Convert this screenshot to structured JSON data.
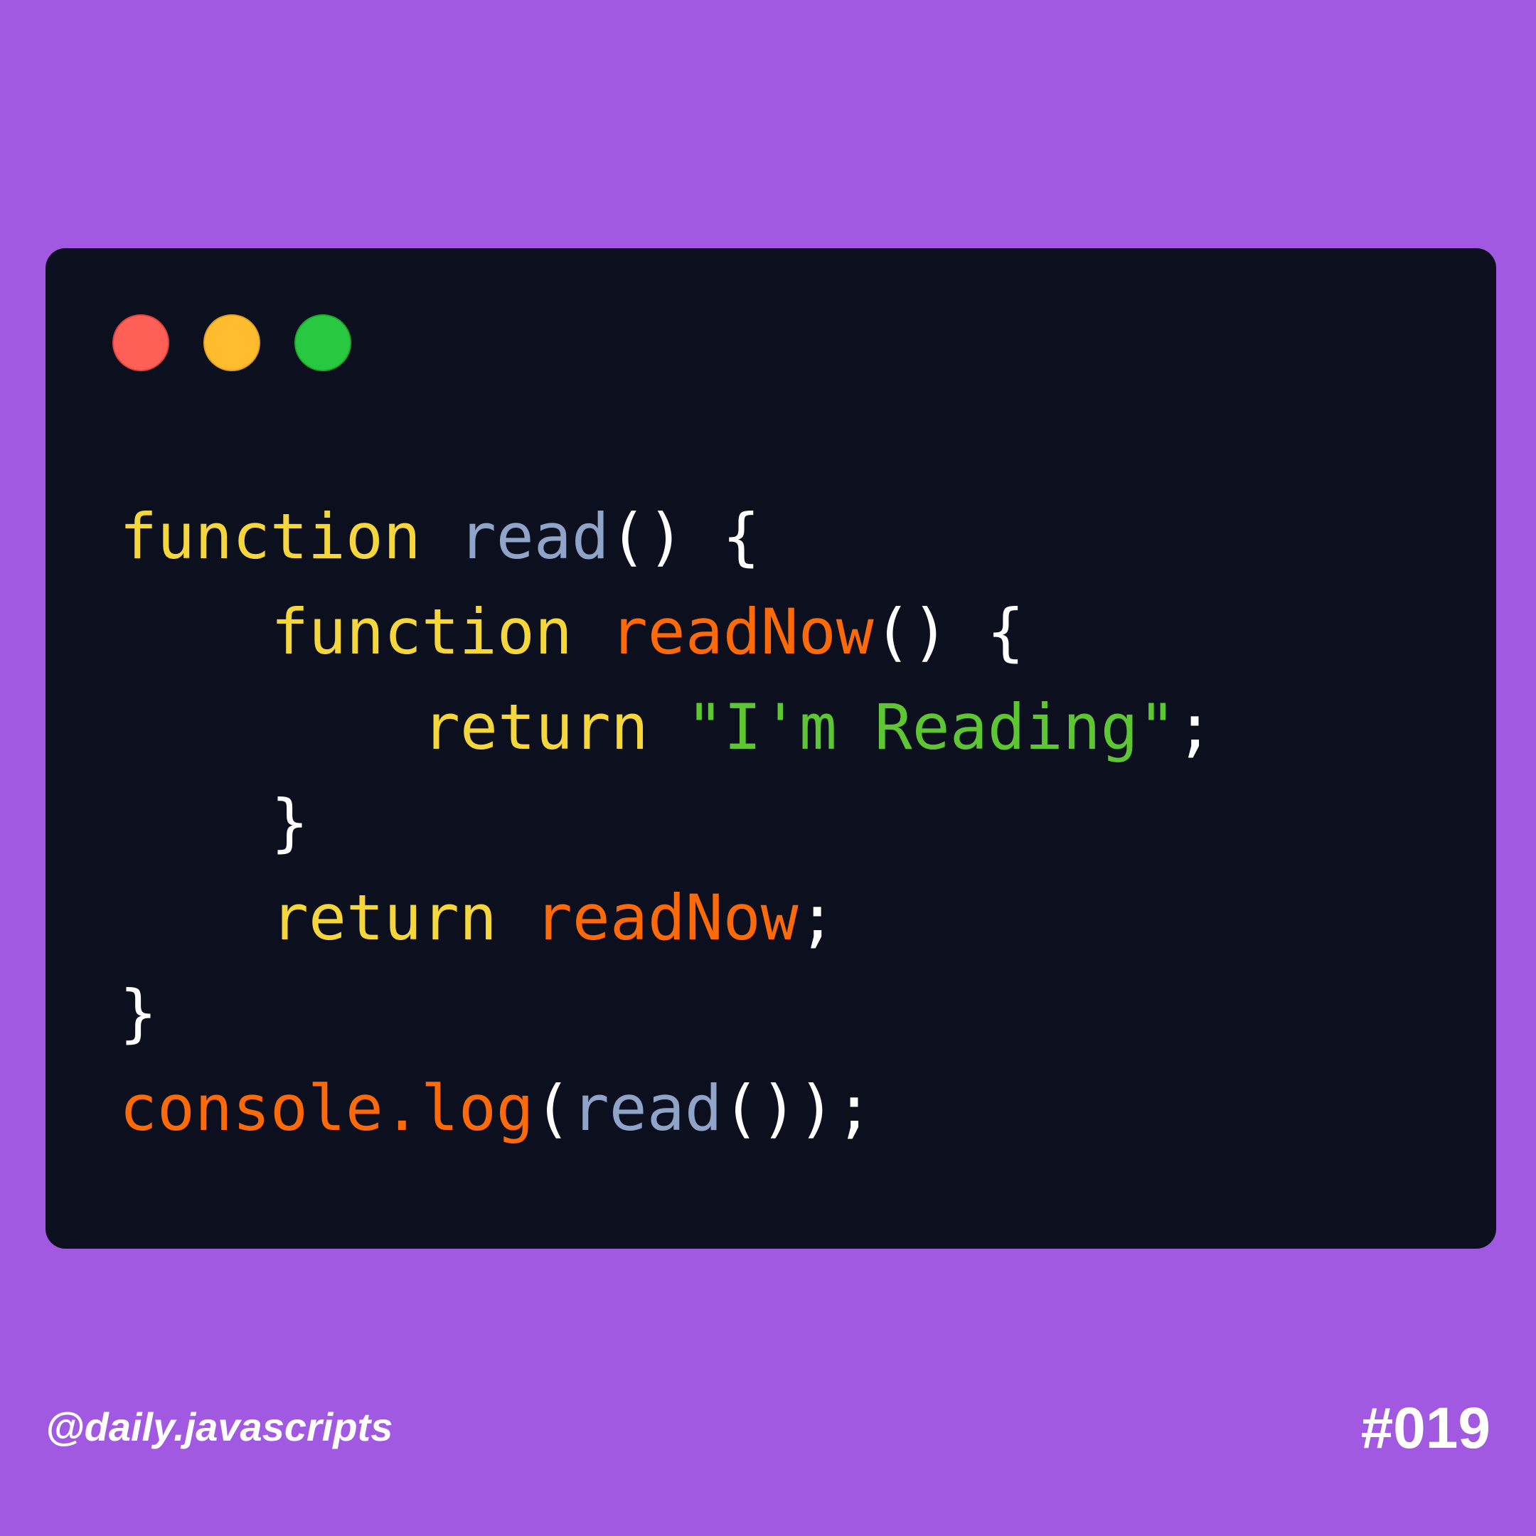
{
  "colors": {
    "background": "#a259e2",
    "window": "#0c0f1e",
    "keyword": "#f5d73c",
    "function_name_blue": "#8fa4c8",
    "function_name_orange": "#ff6a08",
    "string": "#5ec633",
    "punctuation": "#ffffff"
  },
  "window_controls": {
    "close_color": "#fe5f57",
    "minimize_color": "#febc2e",
    "maximize_color": "#28c840"
  },
  "code": {
    "line1": {
      "kw": "function",
      "name": "read",
      "punct": "() {"
    },
    "line2": {
      "kw": "function",
      "name": "readNow",
      "punct": "() {"
    },
    "line3": {
      "kw": "return",
      "str": "\"I'm Reading\"",
      "punct": ";"
    },
    "line4": {
      "punct": "}"
    },
    "line5": {
      "kw": "return",
      "name": "readNow",
      "punct": ";"
    },
    "line6": {
      "punct": "}"
    },
    "line7": {
      "obj": "console.log",
      "open": "(",
      "name": "read",
      "punct": "());"
    }
  },
  "footer": {
    "handle": "@daily.javascripts",
    "number": "#019"
  }
}
